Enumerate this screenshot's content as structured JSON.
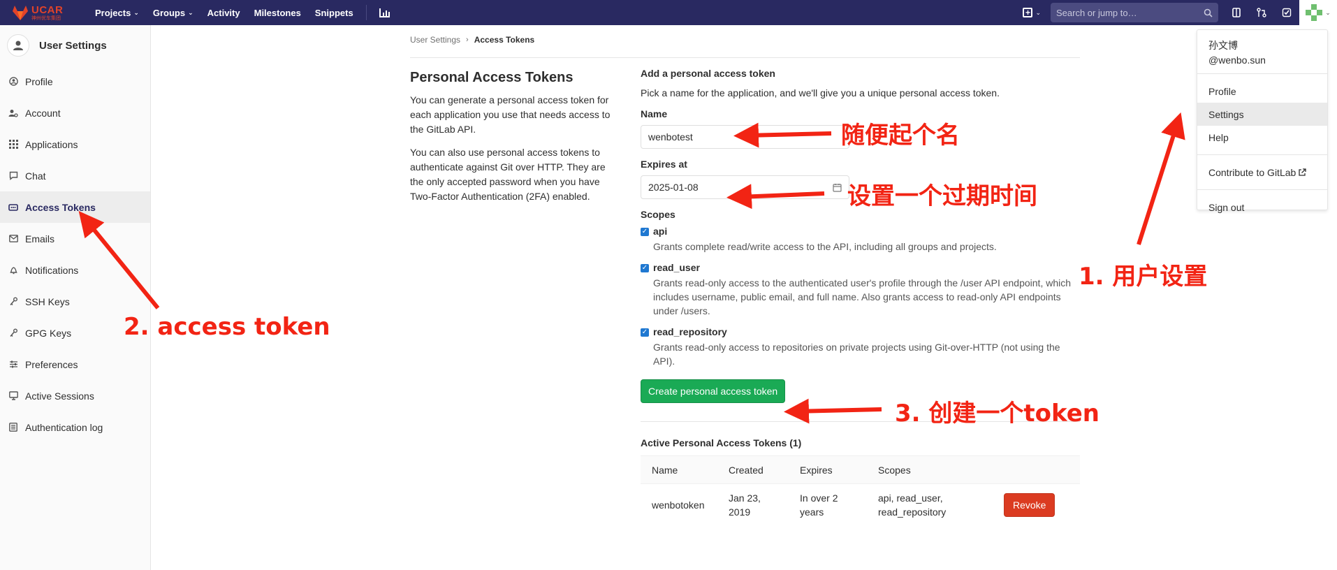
{
  "navbar": {
    "logo_text": "UCAR",
    "logo_sub": "神州优车集团",
    "items": [
      {
        "label": "Projects",
        "dropdown": true
      },
      {
        "label": "Groups",
        "dropdown": true
      },
      {
        "label": "Activity",
        "dropdown": false
      },
      {
        "label": "Milestones",
        "dropdown": false
      },
      {
        "label": "Snippets",
        "dropdown": false
      }
    ],
    "search_placeholder": "Search or jump to…"
  },
  "sidebar": {
    "title": "User Settings",
    "items": [
      {
        "label": "Profile",
        "icon": "profile-icon",
        "active": false
      },
      {
        "label": "Account",
        "icon": "account-icon",
        "active": false
      },
      {
        "label": "Applications",
        "icon": "applications-icon",
        "active": false
      },
      {
        "label": "Chat",
        "icon": "chat-icon",
        "active": false
      },
      {
        "label": "Access Tokens",
        "icon": "token-icon",
        "active": true
      },
      {
        "label": "Emails",
        "icon": "mail-icon",
        "active": false
      },
      {
        "label": "Notifications",
        "icon": "bell-icon",
        "active": false
      },
      {
        "label": "SSH Keys",
        "icon": "key-icon",
        "active": false
      },
      {
        "label": "GPG Keys",
        "icon": "key-icon",
        "active": false
      },
      {
        "label": "Preferences",
        "icon": "sliders-icon",
        "active": false
      },
      {
        "label": "Active Sessions",
        "icon": "monitor-icon",
        "active": false
      },
      {
        "label": "Authentication log",
        "icon": "log-icon",
        "active": false
      }
    ]
  },
  "breadcrumb": {
    "parent": "User Settings",
    "current": "Access Tokens"
  },
  "intro": {
    "title": "Personal Access Tokens",
    "p1": "You can generate a personal access token for each application you use that needs access to the GitLab API.",
    "p2": "You can also use personal access tokens to authenticate against Git over HTTP. They are the only accepted password when you have Two-Factor Authentication (2FA) enabled."
  },
  "form": {
    "heading": "Add a personal access token",
    "description": "Pick a name for the application, and we'll give you a unique personal access token.",
    "name_label": "Name",
    "name_value": "wenbotest",
    "expires_label": "Expires at",
    "expires_value": "2025-01-08",
    "scopes_label": "Scopes",
    "scopes": [
      {
        "name": "api",
        "desc": "Grants complete read/write access to the API, including all groups and projects.",
        "checked": true
      },
      {
        "name": "read_user",
        "desc": "Grants read-only access to the authenticated user's profile through the /user API endpoint, which includes username, public email, and full name. Also grants access to read-only API endpoints under /users.",
        "checked": true
      },
      {
        "name": "read_repository",
        "desc": "Grants read-only access to repositories on private projects using Git-over-HTTP (not using the API).",
        "checked": true
      }
    ],
    "create_label": "Create personal access token"
  },
  "active_tokens": {
    "heading": "Active Personal Access Tokens (1)",
    "columns": [
      "Name",
      "Created",
      "Expires",
      "Scopes"
    ],
    "rows": [
      {
        "name": "wenbotoken",
        "created": "Jan 23, 2019",
        "expires": "In over 2 years",
        "scopes": "api, read_user, read_repository",
        "revoke": "Revoke"
      }
    ]
  },
  "user_dropdown": {
    "name": "孙文博",
    "username": "@wenbo.sun",
    "items": [
      "Profile",
      "Settings",
      "Help"
    ],
    "contribute": "Contribute to GitLab",
    "signout": "Sign out",
    "highlighted": "Settings"
  },
  "annotations": {
    "name_hint": "随便起个名",
    "expires_hint": "设置一个过期时间",
    "step1": "1. 用户设置",
    "step2": "2. access token",
    "step3": "3. 创建一个token",
    "color": "#f22414"
  },
  "colors": {
    "navbar": "#292961",
    "create_button": "#1aaa55",
    "revoke_button": "#db3b21",
    "checkbox": "#1f78d1"
  }
}
